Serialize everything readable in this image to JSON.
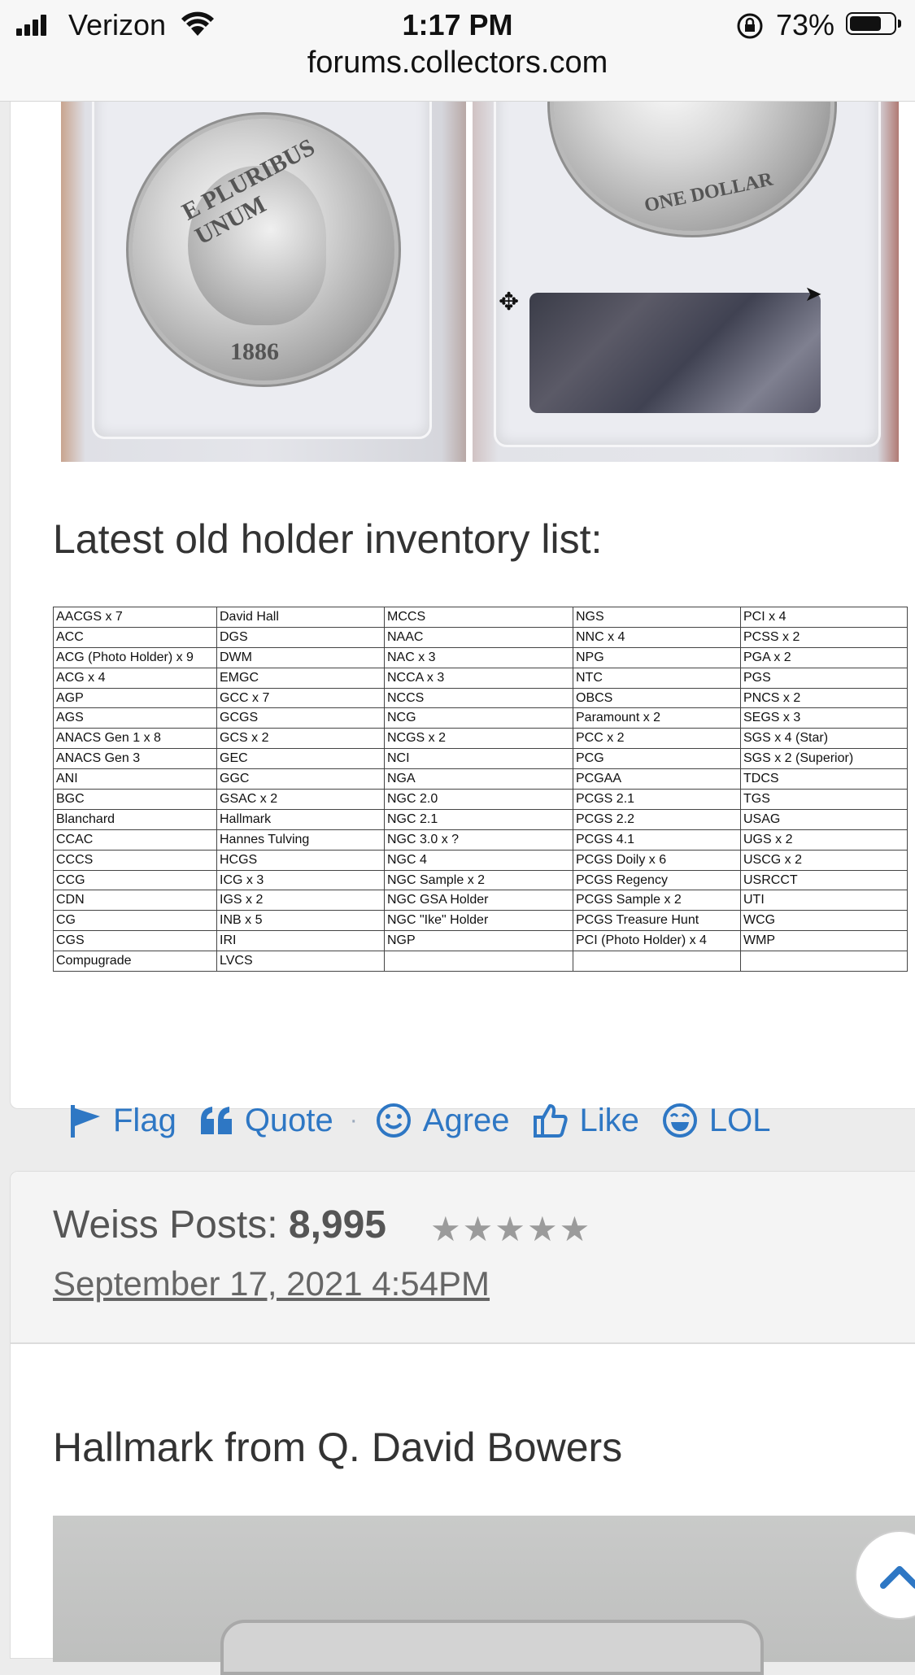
{
  "status_bar": {
    "carrier": "Verizon",
    "time": "1:17 PM",
    "battery": "73%",
    "battery_level": 0.73
  },
  "url_bar": {
    "url": "forums.collectors.com"
  },
  "post1": {
    "coin_obverse_year": "1886",
    "coin_obverse_legend": "E PLURIBUS UNUM",
    "coin_reverse_legend": "ONE DOLLAR",
    "heading": "Latest old holder inventory list:",
    "inventory_columns": [
      [
        "AACGS x 7",
        "ACC",
        "ACG (Photo Holder) x 9",
        "ACG x 4",
        "AGP",
        "AGS",
        "ANACS Gen 1 x 8",
        "ANACS Gen 3",
        "ANI",
        "BGC",
        "Blanchard",
        "CCAC",
        "CCCS",
        "CCG",
        "CDN",
        "CG",
        "CGS",
        "Compugrade"
      ],
      [
        "David Hall",
        "DGS",
        "DWM",
        "EMGC",
        "GCC x 7",
        "GCGS",
        "GCS x 2",
        "GEC",
        "GGC",
        "GSAC x 2",
        "Hallmark",
        "Hannes Tulving",
        "HCGS",
        "ICG x 3",
        "IGS x 2",
        "INB x 5",
        "IRI",
        "LVCS"
      ],
      [
        "MCCS",
        "NAAC",
        "NAC x 3",
        "NCCA x 3",
        "NCCS",
        "NCG",
        "NCGS x 2",
        "NCI",
        "NGA",
        "NGC 2.0",
        "NGC 2.1",
        "NGC 3.0 x ?",
        "NGC 4",
        "NGC Sample x 2",
        "NGC GSA Holder",
        "NGC \"Ike\" Holder",
        "NGP",
        ""
      ],
      [
        "NGS",
        "NNC x 4",
        "NPG",
        "NTC",
        "OBCS",
        "Paramount x 2",
        "PCC x 2",
        "PCG",
        "PCGAA",
        "PCGS 2.1",
        "PCGS 2.2",
        "PCGS 4.1",
        "PCGS Doily x 6",
        "PCGS Regency",
        "PCGS Sample x 2",
        "PCGS Treasure Hunt",
        "PCI (Photo Holder) x 4",
        ""
      ],
      [
        "PCI x 4",
        "PCSS x 2",
        "PGA x 2",
        "PGS",
        "PNCS x 2",
        "SEGS x 3",
        "SGS x 4 (Star)",
        "SGS x 2 (Superior)",
        "TDCS",
        "TGS",
        "USAG",
        "UGS x 2",
        "USCG x 2",
        "USRCCT",
        "UTI",
        "WCG",
        "WMP",
        ""
      ]
    ],
    "actions": {
      "flag": "Flag",
      "quote": "Quote",
      "separator": "·",
      "agree": "Agree",
      "like": "Like",
      "lol": "LOL"
    }
  },
  "post2": {
    "author": "Weiss",
    "posts_label": "Posts:",
    "posts_count": "8,995",
    "stars": "★★★★★",
    "date": "September 17, 2021 4:54PM",
    "title": "Hallmark from Q. David Bowers"
  },
  "colors": {
    "link_blue": "#2e77c4",
    "text_dark": "#333333",
    "card_header_bg": "#f4f4f4",
    "page_bg": "#ececec"
  }
}
